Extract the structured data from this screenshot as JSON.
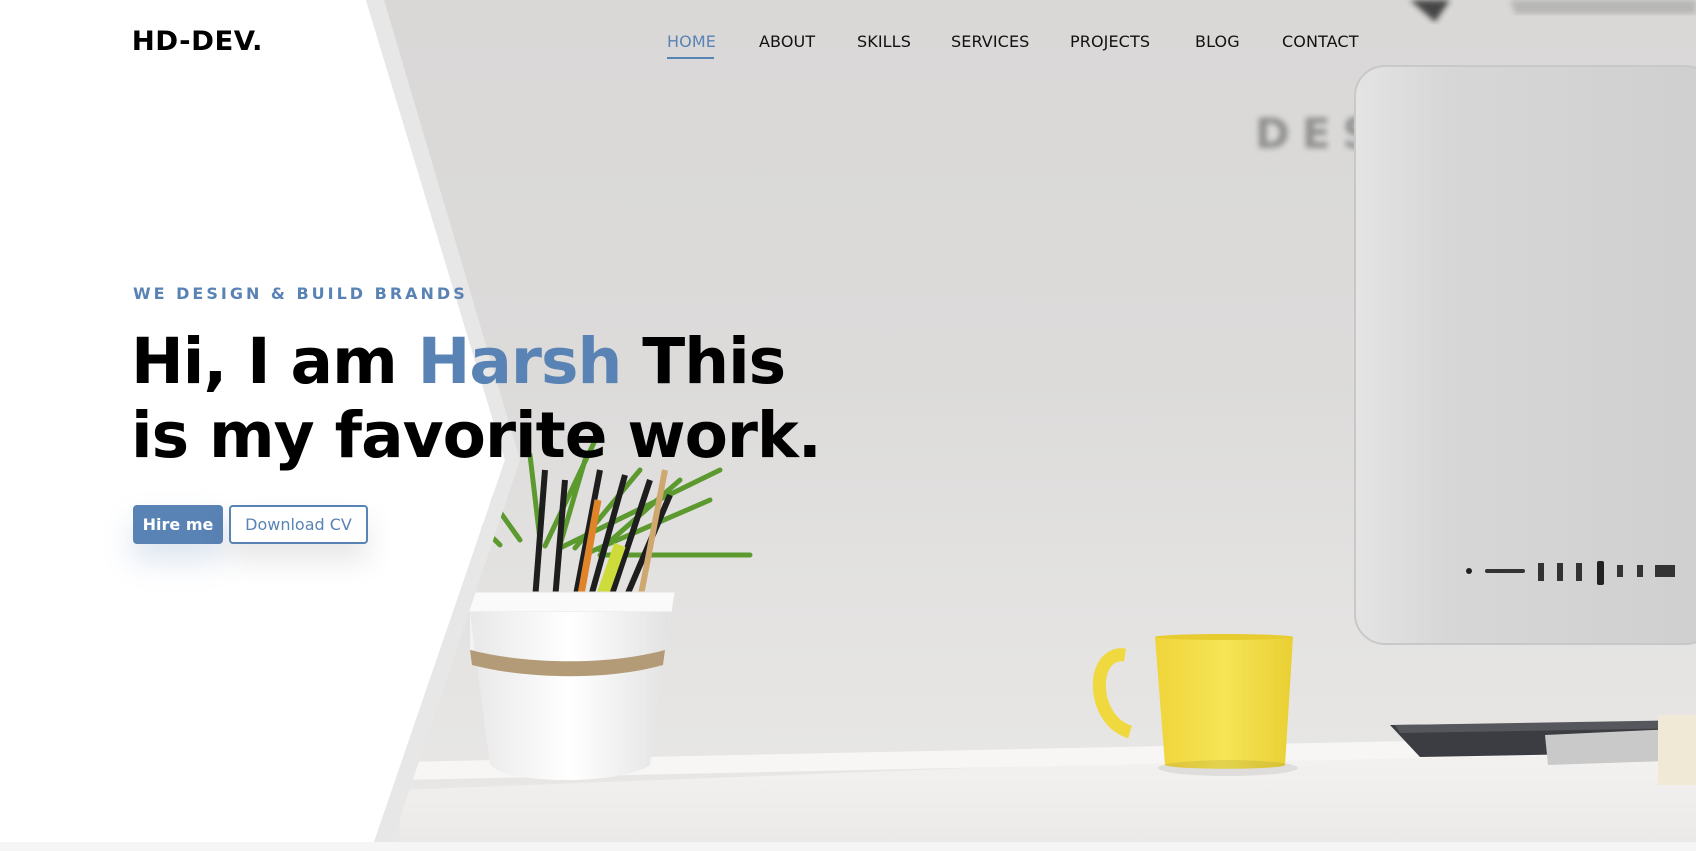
{
  "brand": {
    "logo": "HD-DEV."
  },
  "nav": {
    "items": [
      {
        "label": "HOME",
        "active": true
      },
      {
        "label": "ABOUT",
        "active": false
      },
      {
        "label": "SKILLS",
        "active": false
      },
      {
        "label": "SERVICES",
        "active": false
      },
      {
        "label": "PROJECTS",
        "active": false
      },
      {
        "label": "BLOG",
        "active": false
      },
      {
        "label": "CONTACT",
        "active": false
      }
    ]
  },
  "hero": {
    "tagline": "WE DESIGN & BUILD BRANDS",
    "headline_part1": "Hi, I am ",
    "headline_highlight": "Harsh",
    "headline_part2": " This is my favorite work.",
    "primary_button": "Hire me",
    "secondary_button": "Download CV",
    "background_image": "desk-workspace-photo",
    "background_wall_text": "DES"
  },
  "colors": {
    "accent": "#5a83b5",
    "text": "#000000",
    "mug": "#f4df45",
    "background": "#ffffff"
  }
}
